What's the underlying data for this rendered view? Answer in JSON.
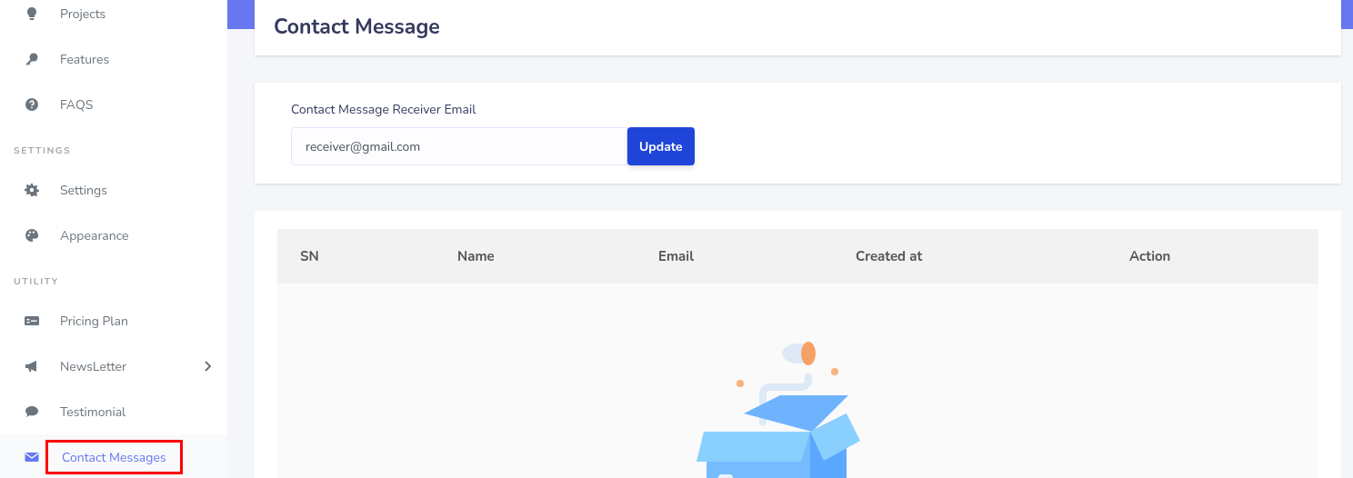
{
  "sidebar": {
    "groups": [
      {
        "items": [
          {
            "label": "Projects",
            "selected": false,
            "expandable": false,
            "highlighted": false
          },
          {
            "label": "Features",
            "selected": false,
            "expandable": false,
            "highlighted": false
          },
          {
            "label": "FAQS",
            "selected": false,
            "expandable": false,
            "highlighted": false
          }
        ]
      },
      {
        "heading": "SETTINGS",
        "items": [
          {
            "label": "Settings",
            "selected": false,
            "expandable": false,
            "highlighted": false
          },
          {
            "label": "Appearance",
            "selected": false,
            "expandable": false,
            "highlighted": false
          }
        ]
      },
      {
        "heading": "UTILITY",
        "items": [
          {
            "label": "Pricing Plan",
            "selected": false,
            "expandable": false,
            "highlighted": false
          },
          {
            "label": "NewsLetter",
            "selected": false,
            "expandable": true,
            "highlighted": false
          },
          {
            "label": "Testimonial",
            "selected": false,
            "expandable": false,
            "highlighted": false
          },
          {
            "label": "Contact Messages",
            "selected": true,
            "expandable": false,
            "highlighted": true
          }
        ]
      }
    ]
  },
  "page_title": "Contact Message",
  "form": {
    "label": "Contact Message Receiver Email",
    "value": "receiver@gmail.com",
    "button": "Update"
  },
  "table": {
    "columns": [
      "SN",
      "Name",
      "Email",
      "Created at",
      "Action"
    ],
    "empty": true
  }
}
